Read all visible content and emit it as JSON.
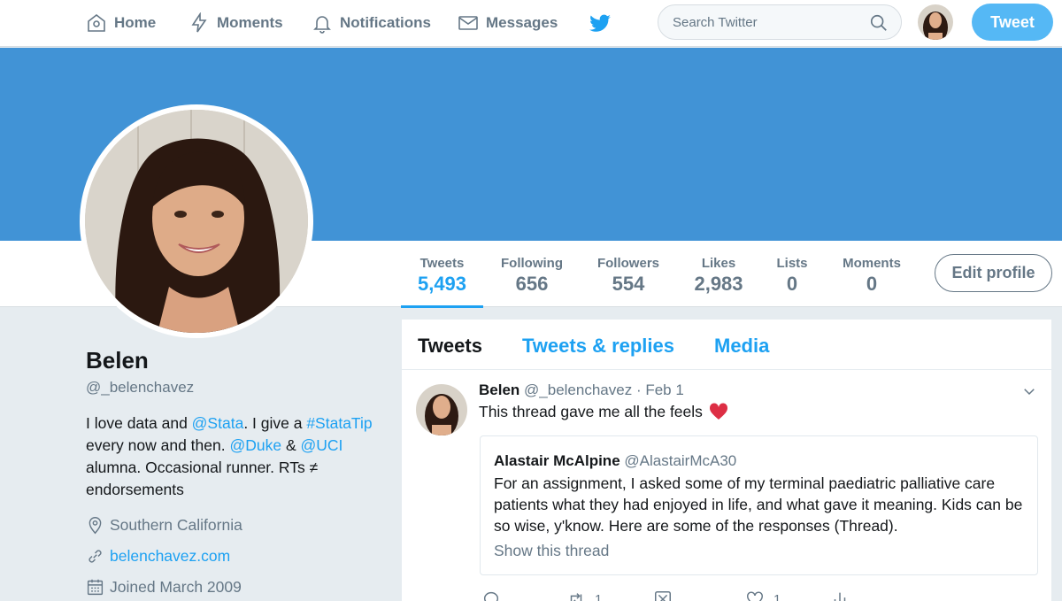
{
  "nav": {
    "home": "Home",
    "moments": "Moments",
    "notifications": "Notifications",
    "messages": "Messages",
    "search_placeholder": "Search Twitter",
    "tweet_button": "Tweet"
  },
  "colors": {
    "accent": "#1da1f2",
    "banner": "#4193d6",
    "background": "#e6ecf0",
    "heart": "#e0245e"
  },
  "stats": [
    {
      "label": "Tweets",
      "value": "5,493",
      "active": true
    },
    {
      "label": "Following",
      "value": "656"
    },
    {
      "label": "Followers",
      "value": "554"
    },
    {
      "label": "Likes",
      "value": "2,983"
    },
    {
      "label": "Lists",
      "value": "0"
    },
    {
      "label": "Moments",
      "value": "0"
    }
  ],
  "edit_profile": "Edit profile",
  "profile": {
    "name": "Belen",
    "handle": "@_belenchavez",
    "bio": {
      "t1": "I love data and ",
      "m1": "@Stata",
      "t2": ". I give a ",
      "h1": "#StataTip",
      "t3": " every now and then. ",
      "m2": "@Duke",
      "t4": " & ",
      "m3": "@UCI",
      "t5": " alumna. Occasional runner. RTs ≠ endorsements"
    },
    "location": "Southern California",
    "website": "belenchavez.com",
    "joined": "Joined March 2009"
  },
  "tabs": {
    "tweets": "Tweets",
    "replies": "Tweets & replies",
    "media": "Media"
  },
  "tweet": {
    "name": "Belen",
    "handle": "@_belenchavez",
    "sep": "·",
    "date": "Feb 1",
    "text": "This thread gave me all the feels",
    "quote": {
      "name": "Alastair McAlpine",
      "handle": "@AlastairMcA30",
      "text": "For an assignment, I asked some of my terminal paediatric palliative care patients what they had enjoyed in life, and what gave it meaning. Kids can be so wise, y'know. Here are some of the responses (Thread).",
      "link": "Show this thread"
    },
    "retweets": "1",
    "likes": "1"
  }
}
